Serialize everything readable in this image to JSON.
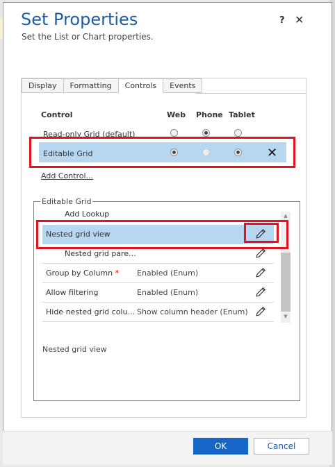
{
  "dialog": {
    "title": "Set Properties",
    "subtitle": "Set the List or Chart properties.",
    "help_label": "?",
    "close_label": "✕"
  },
  "tabs": [
    {
      "label": "Display"
    },
    {
      "label": "Formatting"
    },
    {
      "label": "Controls",
      "active": true
    },
    {
      "label": "Events"
    }
  ],
  "controls_table": {
    "headers": {
      "control": "Control",
      "web": "Web",
      "phone": "Phone",
      "tablet": "Tablet"
    },
    "rows": [
      {
        "name": "Read-only Grid (default)",
        "web": "unchecked",
        "phone": "checked",
        "tablet": "unchecked"
      },
      {
        "name": "Editable Grid",
        "web": "checked",
        "phone": "disabled",
        "tablet": "checked",
        "remove_label": "✕"
      }
    ],
    "add_control_label": "Add Control..."
  },
  "editable_grid": {
    "legend": "Editable Grid",
    "rows": [
      {
        "name": "Add Lookup",
        "value": ""
      },
      {
        "name": "Nested grid view",
        "value": "",
        "selected": true
      },
      {
        "name": "Nested grid pare...",
        "value": ""
      },
      {
        "name": "Group by Column",
        "required": "*",
        "value": "Enabled (Enum)"
      },
      {
        "name": "Allow filtering",
        "value": "Enabled (Enum)"
      },
      {
        "name": "Hide nested grid colu...",
        "value": "Show column header (Enum)"
      }
    ],
    "description": "Nested grid view"
  },
  "footer": {
    "ok_label": "OK",
    "cancel_label": "Cancel"
  },
  "colors": {
    "title": "#1f5da8",
    "selection": "#b7d7f1",
    "highlight_border": "#e0141e",
    "primary_button": "#1666c7"
  }
}
